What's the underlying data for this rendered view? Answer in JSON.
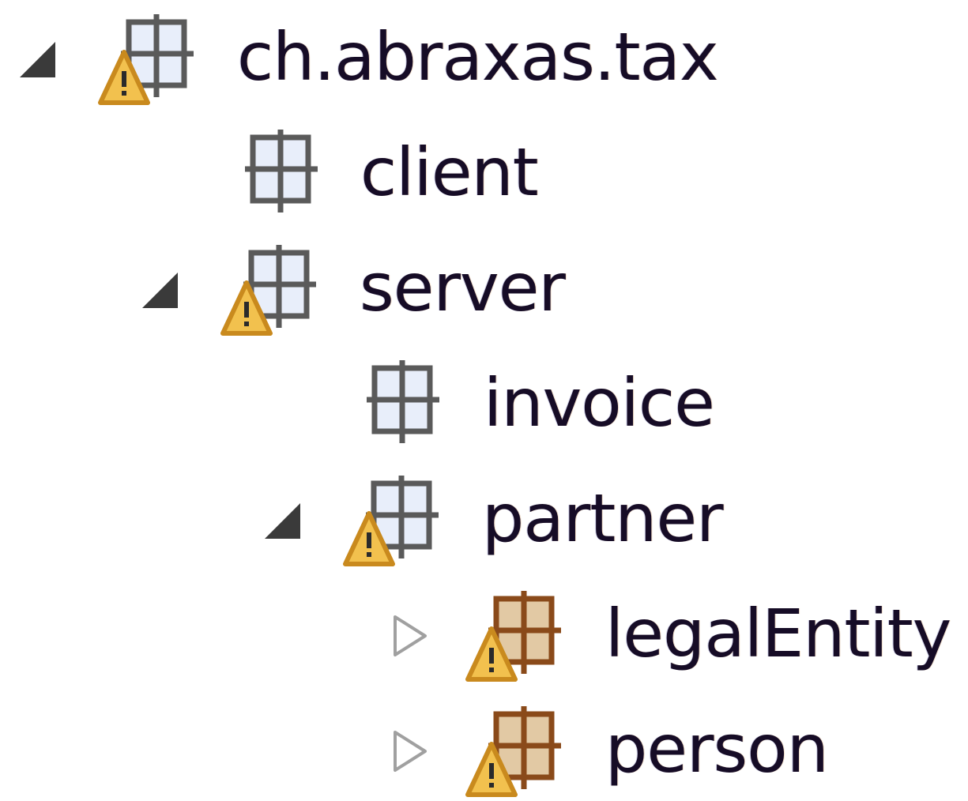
{
  "tree": {
    "nodes": [
      {
        "label": "ch.abraxas.tax",
        "expanded": true,
        "twisty": "expanded",
        "icon": "package-icon",
        "warning": true,
        "folder_style": "plain"
      },
      {
        "label": "client",
        "expanded": false,
        "twisty": "none",
        "icon": "package-icon",
        "warning": false,
        "folder_style": "plain"
      },
      {
        "label": "server",
        "expanded": true,
        "twisty": "expanded",
        "icon": "package-icon",
        "warning": true,
        "folder_style": "plain"
      },
      {
        "label": "invoice",
        "expanded": false,
        "twisty": "none",
        "icon": "package-icon",
        "warning": false,
        "folder_style": "plain"
      },
      {
        "label": "partner",
        "expanded": true,
        "twisty": "expanded",
        "icon": "package-icon",
        "warning": true,
        "folder_style": "plain"
      },
      {
        "label": "legalEntity",
        "expanded": false,
        "twisty": "collapsed",
        "icon": "package-folder-icon",
        "warning": true,
        "folder_style": "brown"
      },
      {
        "label": "person",
        "expanded": false,
        "twisty": "collapsed",
        "icon": "package-folder-icon",
        "warning": true,
        "folder_style": "brown"
      }
    ]
  },
  "colors": {
    "text": "#160c26",
    "twisty_expanded": "#3a3a3a",
    "twisty_collapsed": "#a0a0a0",
    "package_border": "#5a5a5a",
    "package_fill": "#e8eefa",
    "folder_border": "#8a4a1a",
    "folder_fill": "#e2c9a4",
    "warning_fill": "#f2c14e",
    "warning_border": "#c98a1e"
  }
}
